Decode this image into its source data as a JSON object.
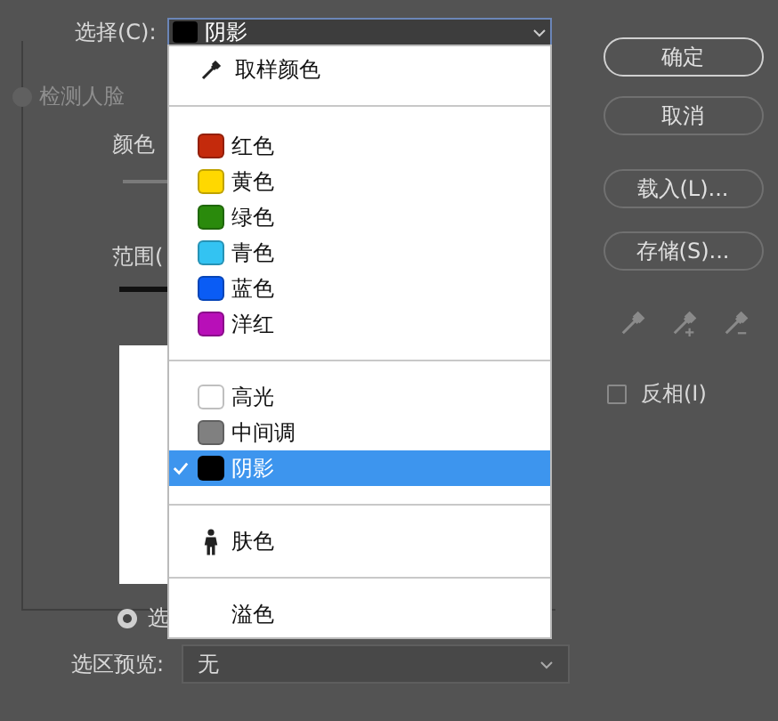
{
  "select": {
    "label": "选择(C):",
    "value": "阴影"
  },
  "detect_faces": {
    "label": "检测人脸",
    "checked": false,
    "disabled": true
  },
  "fuzziness_label": "颜色",
  "range_label": "范围(",
  "view_radio": {
    "label": "选",
    "selected": true
  },
  "menu": [
    {
      "kind": "eyedropper",
      "label": "取样颜色",
      "selected": false
    },
    {
      "kind": "divider"
    },
    {
      "kind": "swatch",
      "label": "红色",
      "color": "#c42a0c",
      "selected": false
    },
    {
      "kind": "swatch",
      "label": "黄色",
      "color": "#ffd800",
      "selected": false
    },
    {
      "kind": "swatch",
      "label": "绿色",
      "color": "#2a8a0c",
      "selected": false
    },
    {
      "kind": "swatch",
      "label": "青色",
      "color": "#33c3f2",
      "selected": false
    },
    {
      "kind": "swatch",
      "label": "蓝色",
      "color": "#0a5cf5",
      "selected": false
    },
    {
      "kind": "swatch",
      "label": "洋红",
      "color": "#b80fb8",
      "selected": false
    },
    {
      "kind": "divider"
    },
    {
      "kind": "swatch",
      "label": "高光",
      "color": "#ffffff",
      "selected": false
    },
    {
      "kind": "swatch",
      "label": "中间调",
      "color": "#808080",
      "selected": false
    },
    {
      "kind": "swatch",
      "label": "阴影",
      "color": "#000000",
      "selected": true
    },
    {
      "kind": "divider"
    },
    {
      "kind": "person",
      "label": "肤色",
      "selected": false
    },
    {
      "kind": "divider"
    },
    {
      "kind": "plain",
      "label": "溢色",
      "selected": false
    }
  ],
  "preview": {
    "label": "选区预览:",
    "value": "无"
  },
  "buttons": [
    {
      "label": "确定",
      "default": true
    },
    {
      "label": "取消",
      "default": false
    },
    {
      "label": "载入(L)...",
      "default": false
    },
    {
      "label": "存储(S)...",
      "default": false
    }
  ],
  "eyedroppers": [
    {
      "kind": "plain"
    },
    {
      "kind": "plus"
    },
    {
      "kind": "minus"
    }
  ],
  "invert": {
    "label": "反相(I)",
    "checked": false
  }
}
